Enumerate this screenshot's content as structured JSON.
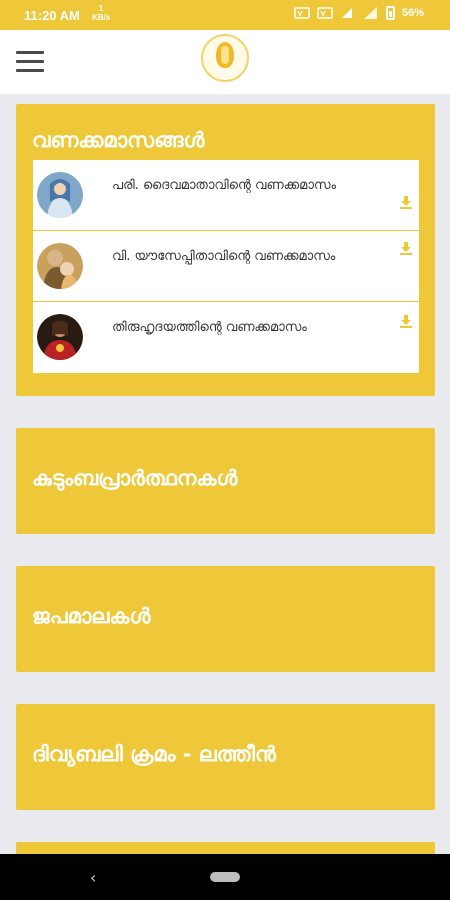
{
  "status_bar": {
    "time": "11:20 AM",
    "speed_value": "1",
    "speed_unit": "KB/s",
    "battery": "56%",
    "icons": [
      "volte-icon",
      "volte-icon",
      "lte-4g-icon",
      "signal-icon",
      "battery-icon"
    ]
  },
  "app_bar": {
    "menu_icon": "hamburger-menu-icon",
    "logo_icon": "praying-hands-logo"
  },
  "sections": {
    "vanakkamasangal": {
      "title": "വണക്കമാസങ്ങൾ",
      "items": [
        {
          "label": "പരി. ദൈവമാതാവിന്റെ വണക്കമാസം",
          "avatar": "mary-avatar",
          "action_icon": "download-icon"
        },
        {
          "label": "വി. യൗസേപ്പിതാവിന്റെ വണക്കമാസം",
          "avatar": "joseph-avatar",
          "action_icon": "download-icon"
        },
        {
          "label": "തിരുഹൃദയത്തിന്റെ വണക്കമാസം",
          "avatar": "sacred-heart-avatar",
          "action_icon": "download-icon"
        }
      ]
    },
    "kudumba": {
      "title": "കുടുംബപ്രാർത്ഥനകൾ"
    },
    "japamala": {
      "title": "ജപമാലകൾ"
    },
    "divyabali": {
      "title": "ദിവ്യബലി ക്രമം - ലത്തീൻ"
    }
  },
  "nav_bar": {
    "back_icon": "back-chevron-icon",
    "home_icon": "home-pill-icon"
  },
  "colors": {
    "accent": "#efc83a",
    "background": "#e9eaee",
    "card_text": "#ffffff",
    "item_text": "#333333"
  }
}
